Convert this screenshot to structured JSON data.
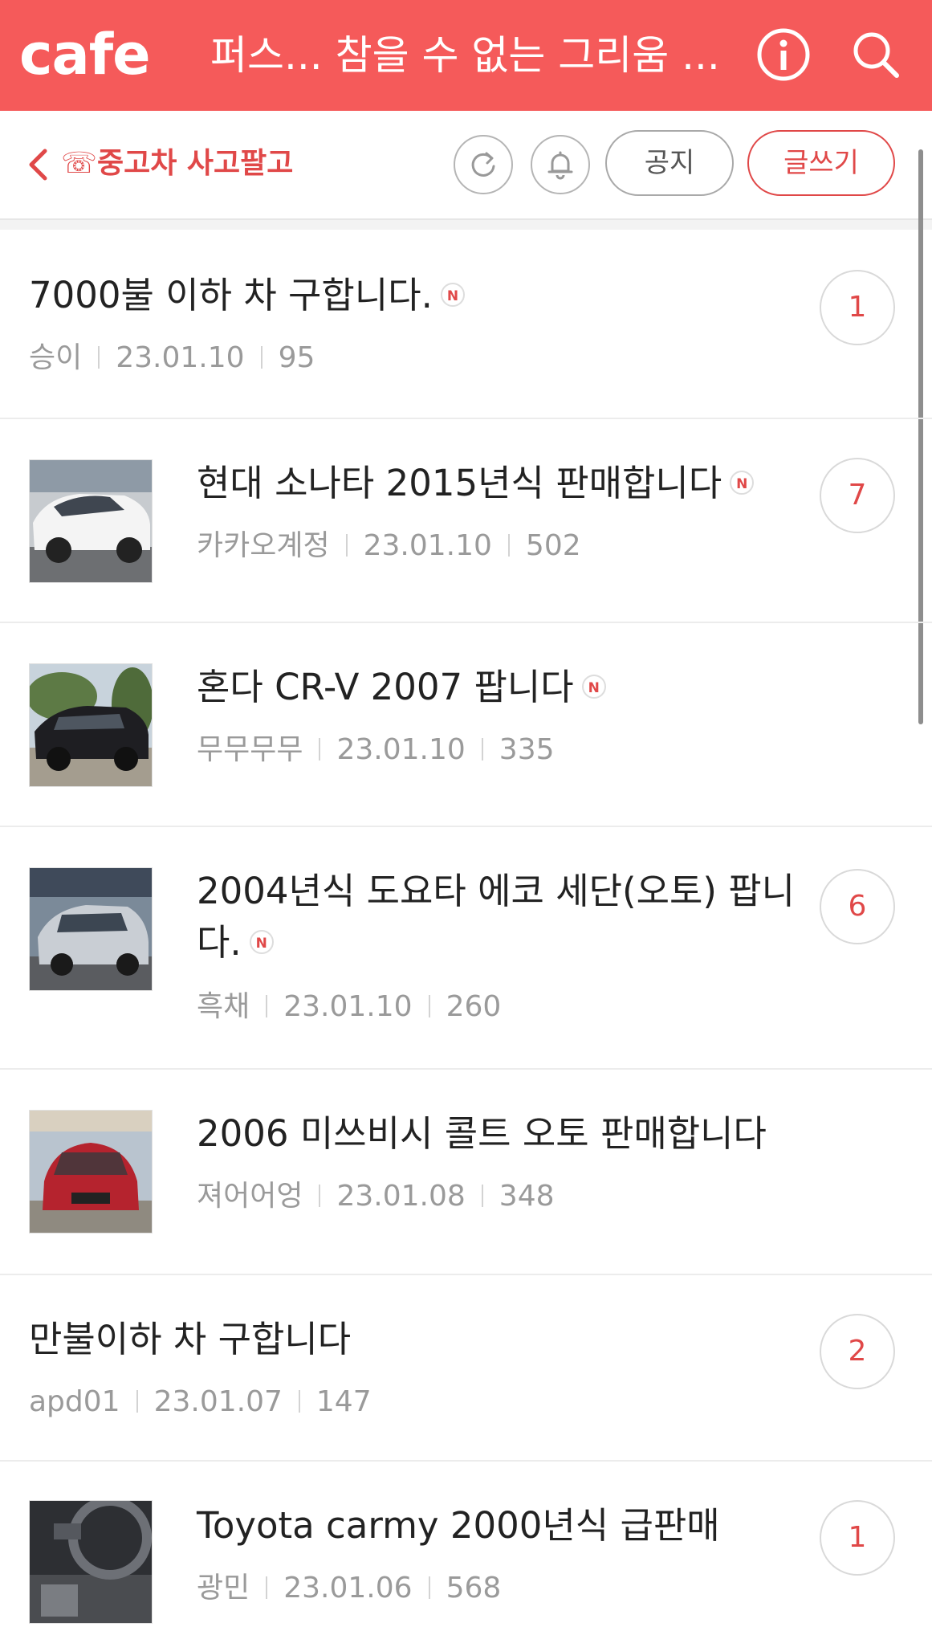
{
  "header": {
    "logo": "cafe",
    "cafe_name": "퍼스... 참을 수 없는 그리움 ...",
    "bg_color": "#f55a5a",
    "icons": [
      "info-icon",
      "search-icon"
    ]
  },
  "board": {
    "name": "☏중고차 사고팔고",
    "notice_label": "공지",
    "write_label": "글쓰기",
    "accent_color": "#e04848"
  },
  "posts": [
    {
      "title": "7000불 이하 차 구합니다.",
      "is_new": true,
      "new_label": "N",
      "author": "승이",
      "date": "23.01.10",
      "views": "95",
      "comments": "1",
      "has_thumb": false
    },
    {
      "title": "현대 소나타 2015년식 판매합니다",
      "is_new": true,
      "new_label": "N",
      "author": "카카오계정",
      "date": "23.01.10",
      "views": "502",
      "comments": "7",
      "has_thumb": true
    },
    {
      "title": "혼다 CR-V 2007 팝니다",
      "is_new": true,
      "new_label": "N",
      "author": "무무무무",
      "date": "23.01.10",
      "views": "335",
      "comments": "",
      "has_thumb": true
    },
    {
      "title": "2004년식 도요타 에코 세단(오토) 팝니다.",
      "is_new": true,
      "new_label": "N",
      "author": "흑채",
      "date": "23.01.10",
      "views": "260",
      "comments": "6",
      "has_thumb": true
    },
    {
      "title": "2006 미쓰비시 콜트 오토 판매합니다",
      "is_new": false,
      "author": "져어어엉",
      "date": "23.01.08",
      "views": "348",
      "comments": "",
      "has_thumb": true
    },
    {
      "title": "만불이하 차 구합니다",
      "is_new": false,
      "author": "apd01",
      "date": "23.01.07",
      "views": "147",
      "comments": "2",
      "has_thumb": false
    },
    {
      "title": "Toyota carmy 2000년식 급판매",
      "is_new": false,
      "author": "광민",
      "date": "23.01.06",
      "views": "568",
      "comments": "1",
      "has_thumb": true
    }
  ]
}
